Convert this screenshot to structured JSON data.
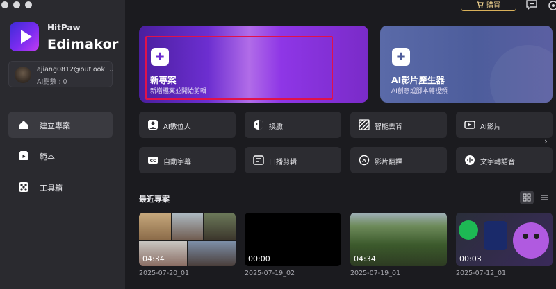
{
  "brand": {
    "sub": "HitPaw",
    "main": "Edimakor"
  },
  "account": {
    "email": "ajiang0812@outlook....",
    "points": "AI點數 : 0"
  },
  "sidebar": {
    "items": [
      {
        "label": "建立專案",
        "icon": "home-icon",
        "active": true
      },
      {
        "label": "範本",
        "icon": "template-icon",
        "active": false
      },
      {
        "label": "工具箱",
        "icon": "toolbox-icon",
        "active": false
      }
    ]
  },
  "topbar": {
    "buy_label": "購買"
  },
  "hero": {
    "new_project": {
      "title": "新專案",
      "subtitle": "新增檔案並開始剪輯"
    },
    "ai_generator": {
      "title": "AI影片產生器",
      "subtitle": "AI創意或腳本轉視頻"
    }
  },
  "tools": [
    {
      "label": "AI數位人",
      "icon": "avatar-icon"
    },
    {
      "label": "換臉",
      "icon": "face-swap-icon"
    },
    {
      "label": "智能去背",
      "icon": "background-remove-icon"
    },
    {
      "label": "AI影片",
      "icon": "ai-video-icon"
    },
    {
      "label": "自動字幕",
      "icon": "caption-icon"
    },
    {
      "label": "口播剪輯",
      "icon": "speech-edit-icon"
    },
    {
      "label": "影片翻譯",
      "icon": "translate-icon"
    },
    {
      "label": "文字轉語音",
      "icon": "text-to-speech-icon"
    }
  ],
  "recent": {
    "title": "最近專案",
    "projects": [
      {
        "name": "2025-07-20_01",
        "duration": "04:34"
      },
      {
        "name": "2025-07-19_02",
        "duration": "00:00"
      },
      {
        "name": "2025-07-19_01",
        "duration": "04:34"
      },
      {
        "name": "2025-07-12_01",
        "duration": "00:03"
      }
    ]
  },
  "colors": {
    "accent": "#7b2cf0",
    "highlight": "#e0124a",
    "buy": "#d9b15a"
  }
}
